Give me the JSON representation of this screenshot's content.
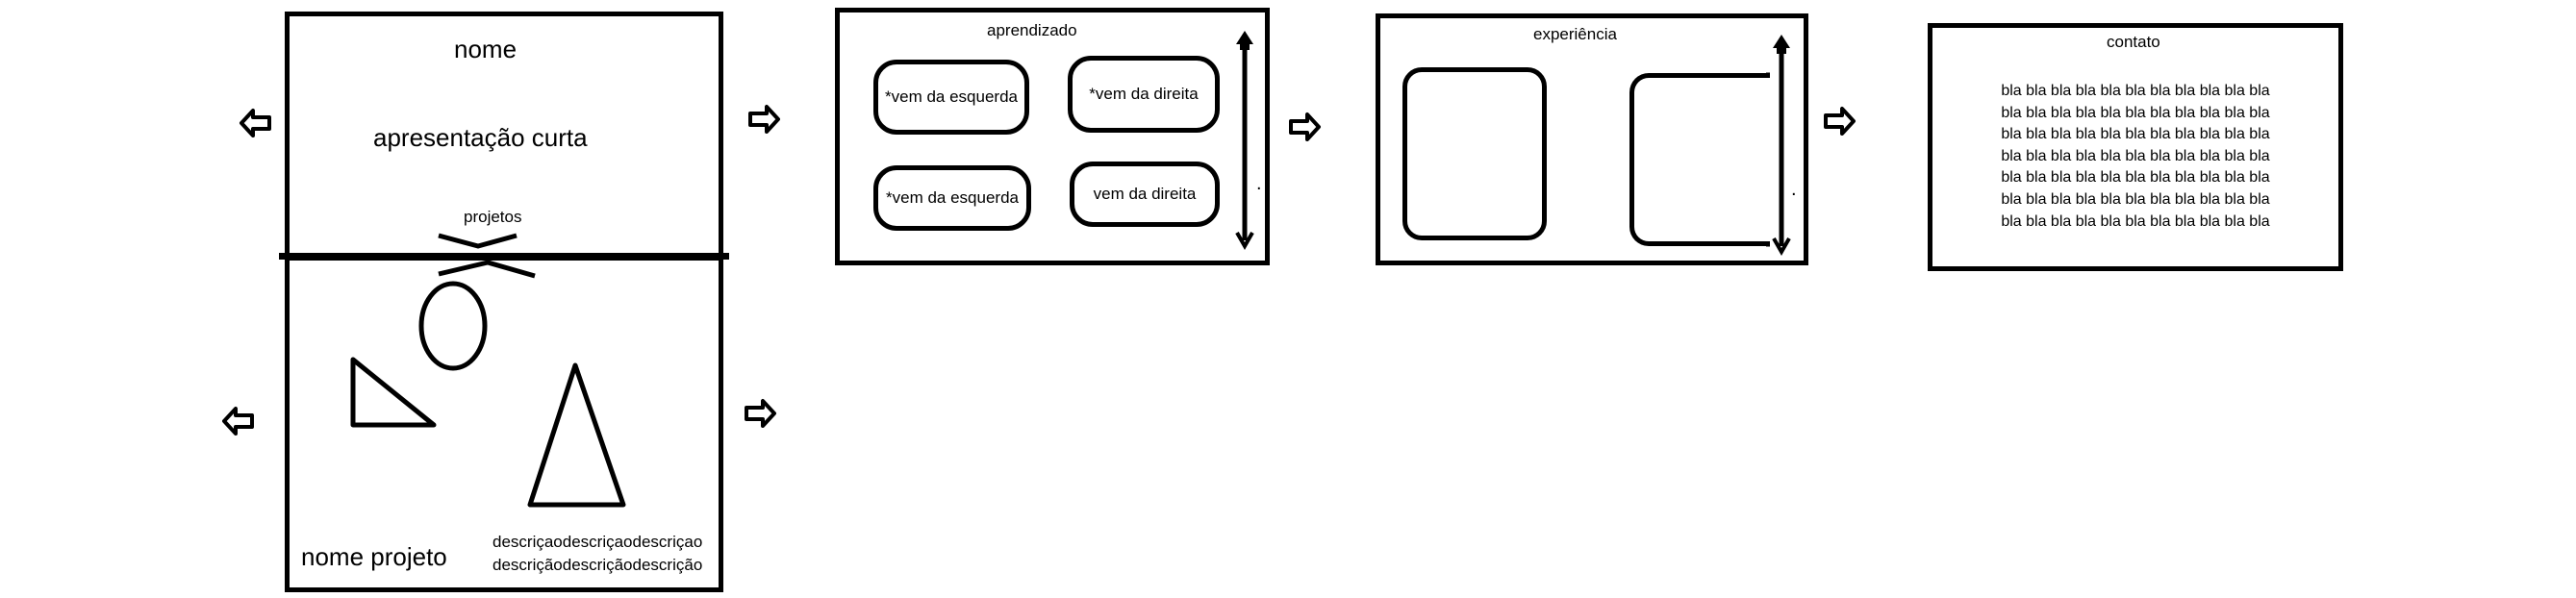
{
  "hero": {
    "name": "nome",
    "intro": "apresentação curta",
    "projects_heading": "projetos"
  },
  "project": {
    "name": "nome projeto",
    "description_lines": [
      "descriçaodescriçaodescriçao",
      "descriçãodescriçãodescrição"
    ]
  },
  "learning": {
    "title": "aprendizado",
    "cards": [
      "*vem da esquerda",
      "*vem da direita",
      "*vem da esquerda",
      "vem da direita"
    ],
    "scroll_dot": "."
  },
  "experience": {
    "title": "experiência",
    "scroll_dot": "."
  },
  "contact": {
    "title": "contato",
    "lines": [
      "bla bla bla bla bla bla bla bla bla bla bla",
      "bla bla bla bla bla bla bla bla bla bla bla",
      "bla bla bla bla bla bla bla bla bla bla bla",
      "bla bla bla bla bla bla bla bla bla bla bla",
      "bla bla bla bla bla bla bla bla bla bla bla",
      "bla bla bla bla bla bla bla bla bla bla bla",
      "bla bla bla bla bla bla bla bla bla bla bla"
    ]
  },
  "colors": {
    "ink": "#000000",
    "paper": "#ffffff"
  }
}
